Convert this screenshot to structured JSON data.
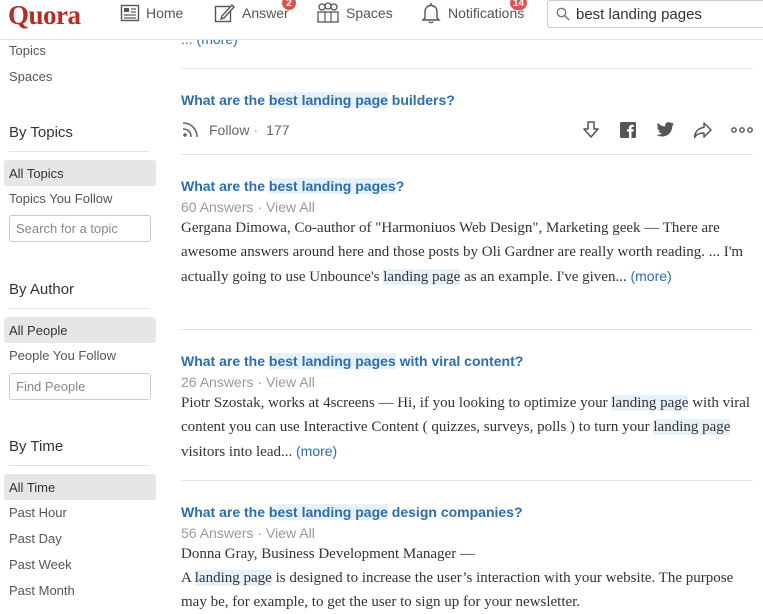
{
  "header": {
    "logo": "Quora",
    "nav": {
      "home": "Home",
      "answer": "Answer",
      "answer_badge": "2",
      "spaces": "Spaces",
      "notifications": "Notifications",
      "notifications_badge": "14"
    },
    "search_value": "best landing pages"
  },
  "sidebar": {
    "links": [
      "Topics",
      "Spaces"
    ],
    "by_topics": {
      "heading": "By Topics",
      "selected": "All Topics",
      "option": "Topics You Follow",
      "search_placeholder": "Search for a topic"
    },
    "by_author": {
      "heading": "By Author",
      "selected": "All People",
      "option": "People You Follow",
      "search_placeholder": "Find People"
    },
    "by_time": {
      "heading": "By Time",
      "selected": "All Time",
      "options": [
        "Past Hour",
        "Past Day",
        "Past Week",
        "Past Month"
      ]
    }
  },
  "results": {
    "top_more": "... (more)",
    "q1": {
      "title_pre": "What are the ",
      "title_hl": "best landing page",
      "title_post": " builders?",
      "follow_label": "Follow",
      "follow_count": "177"
    },
    "q2": {
      "title_pre": "What are the ",
      "title_hl": "best landing pages",
      "title_post": "?",
      "answers": "60 Answers",
      "view_all": "View All",
      "s1": "Gergana Dimowa, Co-author of \"Harmoniuos Web Design\", Marketing geek — There are awesome answers around here and those posts by Oli Gardner are really worth reading.  ... I'm actually going to use Unbounce's ",
      "s_hl": "landing page",
      "s2": " as an example. I've given... ",
      "more": "(more)"
    },
    "q3": {
      "title_pre": "What are the ",
      "title_hl": "best landing pages",
      "title_post": " with viral content?",
      "answers": "26 Answers",
      "view_all": "View All",
      "s1": "Piotr Szostak, works at 4screens — Hi, if you looking to optimize your ",
      "s_hl1": "landing page",
      "s2": " with viral content you can use Interactive Content ( quizzes, surveys, polls ) to turn your ",
      "s_hl2": "landing page",
      "s3": " visitors into lead... ",
      "more": "(more)"
    },
    "q4": {
      "title_pre": "What are the ",
      "title_hl": "best landing page",
      "title_post": " design companies?",
      "answers": "56 Answers",
      "view_all": "View All",
      "line1": "Donna Gray, Business Development Manager —",
      "s1": "A ",
      "s_hl": "landing page",
      "s2": " is designed to increase the user’s interaction with your website. The purpose may be, for example, to get the user to sign up for your newsletter."
    }
  },
  "colors": {
    "brand": "#b92b27",
    "link": "#2b6dad",
    "highlight": "#e7f1fa",
    "badge": "#d9534f"
  }
}
